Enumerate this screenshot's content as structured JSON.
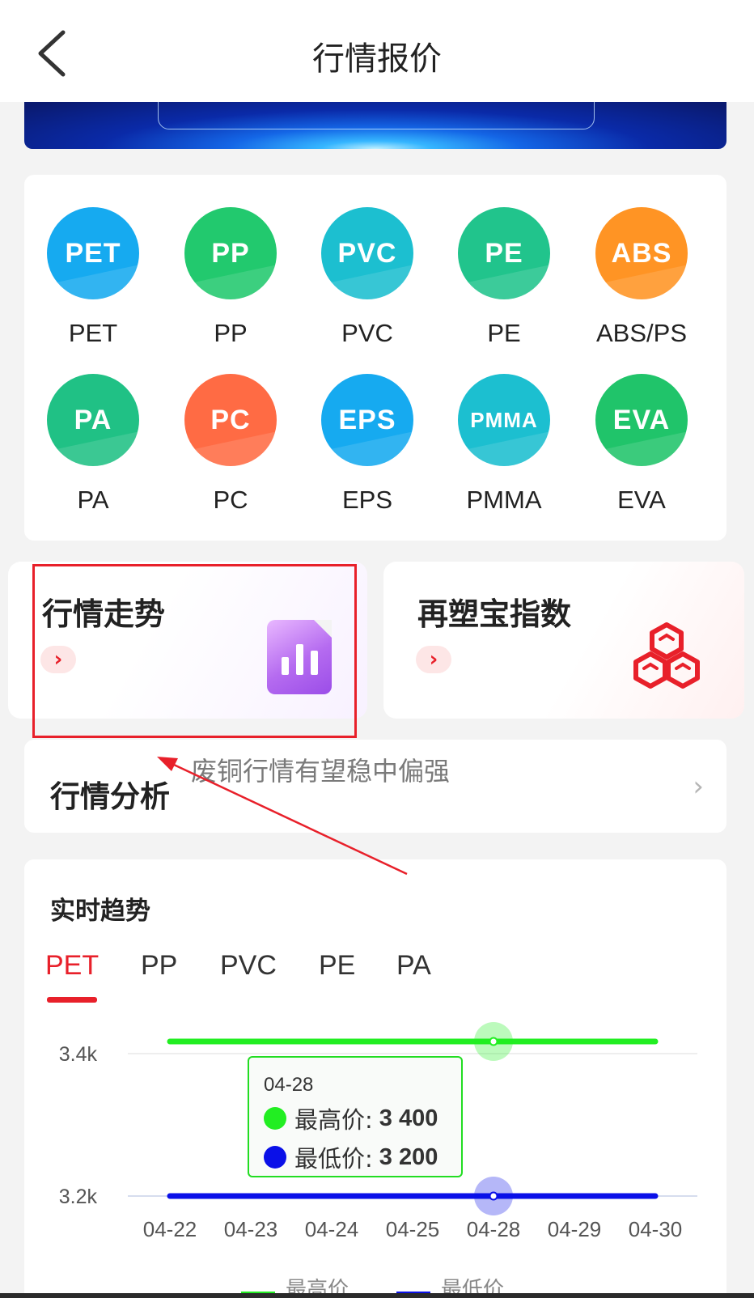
{
  "header": {
    "title": "行情报价",
    "back_icon": "chevron-left-icon"
  },
  "categories": [
    {
      "icon_text": "PET",
      "label": "PET",
      "color": "#16aaf0"
    },
    {
      "icon_text": "PP",
      "label": "PP",
      "color": "#22c96e"
    },
    {
      "icon_text": "PVC",
      "label": "PVC",
      "color": "#1cbfd0"
    },
    {
      "icon_text": "PE",
      "label": "PE",
      "color": "#21c48c"
    },
    {
      "icon_text": "ABS",
      "label": "ABS/PS",
      "color": "#ff9424"
    },
    {
      "icon_text": "PA",
      "label": "PA",
      "color": "#20c185"
    },
    {
      "icon_text": "PC",
      "label": "PC",
      "color": "#ff6b44"
    },
    {
      "icon_text": "EPS",
      "label": "EPS",
      "color": "#16aaf0"
    },
    {
      "icon_text": "PMMA",
      "label": "PMMA",
      "color": "#1cbfd0"
    },
    {
      "icon_text": "EVA",
      "label": "EVA",
      "color": "#20c46a"
    }
  ],
  "features": {
    "trend": {
      "title": "行情走势",
      "go": "›",
      "icon": "bar-chart-report-icon"
    },
    "index": {
      "title": "再塑宝指数",
      "go": "›",
      "icon": "hexagon-cluster-icon"
    }
  },
  "analysis": {
    "title": "行情分析",
    "headline": "废铜行情有望稳中偏强",
    "chevron": "›"
  },
  "realtime": {
    "title": "实时趋势",
    "tabs": [
      "PET",
      "PP",
      "PVC",
      "PE",
      "PA"
    ],
    "active_tab": "PET"
  },
  "tooltip": {
    "date": "04-28",
    "high_label": "最高价:",
    "high_value": "3 400",
    "low_label": "最低价:",
    "low_value": "3 200"
  },
  "chart_data": {
    "type": "line",
    "x": [
      "04-22",
      "04-23",
      "04-24",
      "04-25",
      "04-28",
      "04-29",
      "04-30"
    ],
    "series": [
      {
        "name": "最高价",
        "values": [
          3400,
          3400,
          3400,
          3400,
          3400,
          3400,
          3400
        ],
        "color": "#22ee22"
      },
      {
        "name": "最低价",
        "values": [
          3200,
          3200,
          3200,
          3200,
          3200,
          3200,
          3200
        ],
        "color": "#0a10e8"
      }
    ],
    "y_ticks": [
      "3.4k",
      "3.2k"
    ],
    "ylim": [
      3200,
      3400
    ],
    "highlighted_x": "04-28",
    "legend_position": "bottom"
  },
  "colors": {
    "accent": "#e8202a",
    "annotation": "#e8202a"
  }
}
